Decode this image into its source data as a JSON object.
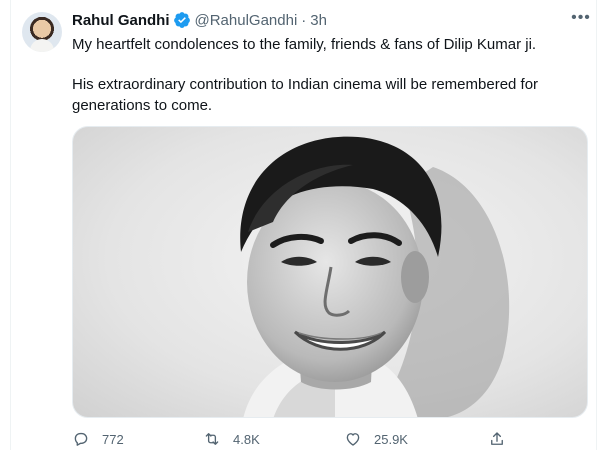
{
  "tweet": {
    "author_name": "Rahul Gandhi",
    "handle": "@RahulGandhi",
    "separator": "·",
    "time": "3h",
    "more_glyph": "•••",
    "text_line1": "My heartfelt condolences to the family, friends & fans of Dilip Kumar ji.",
    "text_line2": "His extraordinary contribution to Indian cinema will be remembered for generations to come."
  },
  "actions": {
    "reply_count": "772",
    "retweet_count": "4.8K",
    "like_count": "25.9K"
  },
  "icons": {
    "verified": "verified-badge-icon",
    "reply": "speech-bubble-icon",
    "retweet": "retweet-arrows-icon",
    "like": "heart-icon",
    "share": "share-upload-icon",
    "more": "more-dots-icon"
  },
  "colors": {
    "verified_blue": "#1d9bf0",
    "text": "#0f1419",
    "secondary_text": "#536471",
    "border": "#eff3f4"
  }
}
